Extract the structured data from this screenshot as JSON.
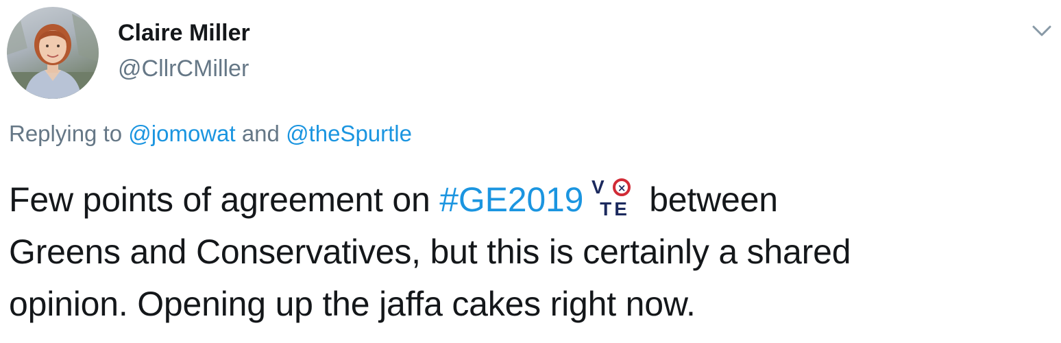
{
  "author": {
    "display_name": "Claire Miller",
    "handle": "@CllrCMiller"
  },
  "reply": {
    "prefix": "Replying to ",
    "mention_1": "@jomowat",
    "joiner": " and ",
    "mention_2": "@theSpurtle"
  },
  "tweet": {
    "line1_before": "Few points of agreement on ",
    "hashtag": "#GE2019",
    "line1_after": "between",
    "line2": "Greens and Conservatives, but this is certainly a shared",
    "line3": "opinion. Opening up the jaffa cakes right now."
  },
  "hashflag": {
    "text_top": "V",
    "text_bottom": "TE",
    "mark": "×"
  },
  "icons": {
    "menu": "chevron-down-icon",
    "hashflag": "vote-hashflag-icon"
  },
  "colors": {
    "link": "#1b95e0",
    "secondary_text": "#657786",
    "primary_text": "#14171a",
    "vote_navy": "#1c2a5e",
    "vote_red": "#d12b36"
  }
}
